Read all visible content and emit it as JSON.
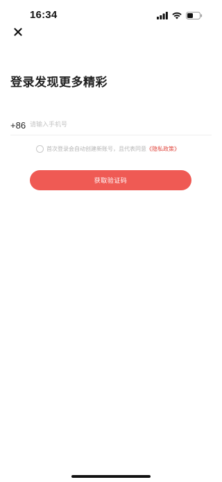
{
  "status_bar": {
    "time": "16:34"
  },
  "header": {
    "close_icon": "close-icon"
  },
  "title": "登录发现更多精彩",
  "phone": {
    "country_code": "+86",
    "placeholder": "请输入手机号",
    "value": ""
  },
  "agreement": {
    "text": "首次登录会自动创建新账号，且代表同意",
    "link": "《隐私政策》",
    "checked": false
  },
  "button": {
    "label": "获取验证码"
  },
  "colors": {
    "accent": "#ef5a54",
    "link": "#e0483f"
  }
}
